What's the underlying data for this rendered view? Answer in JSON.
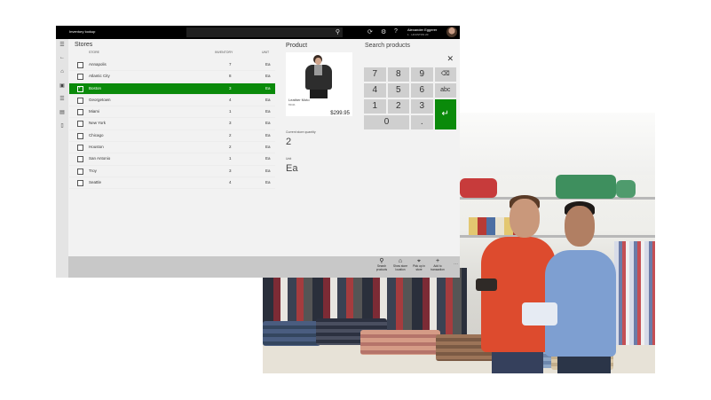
{
  "app": {
    "title": "Inventory lookup",
    "user_name": "Alexander Eggerer",
    "user_store": "1 · HOUSTON 20"
  },
  "titlebar_icons": [
    "refresh-icon",
    "settings-icon",
    "help-icon"
  ],
  "rail_icons": [
    "menu-icon",
    "back-icon",
    "home-icon",
    "products-icon",
    "customers-icon",
    "orders-icon",
    "settings-icon"
  ],
  "stores": {
    "title": "Stores",
    "columns": {
      "store": "STORE",
      "inventory": "INVENTORY",
      "unit": "UNIT"
    },
    "rows": [
      {
        "name": "Annapolis",
        "inventory": "7",
        "unit": "Ea",
        "selected": false
      },
      {
        "name": "Atlantic City",
        "inventory": "8",
        "unit": "Ea",
        "selected": false
      },
      {
        "name": "Boston",
        "inventory": "3",
        "unit": "Ea",
        "selected": true
      },
      {
        "name": "Georgetown",
        "inventory": "4",
        "unit": "Ea",
        "selected": false
      },
      {
        "name": "Miami",
        "inventory": "1",
        "unit": "Ea",
        "selected": false
      },
      {
        "name": "New York",
        "inventory": "3",
        "unit": "Ea",
        "selected": false
      },
      {
        "name": "Chicago",
        "inventory": "2",
        "unit": "Ea",
        "selected": false
      },
      {
        "name": "Houston",
        "inventory": "2",
        "unit": "Ea",
        "selected": false
      },
      {
        "name": "San Antonio",
        "inventory": "1",
        "unit": "Ea",
        "selected": false
      },
      {
        "name": "Troy",
        "inventory": "3",
        "unit": "Ea",
        "selected": false
      },
      {
        "name": "Seattle",
        "inventory": "4",
        "unit": "Ea",
        "selected": false
      }
    ]
  },
  "product": {
    "title": "Product",
    "name": "Leather Moto",
    "id": "81111",
    "price": "$299.95",
    "quantity_label": "Current store quantity",
    "quantity": "2",
    "unit_label": "Unit",
    "unit": "Ea"
  },
  "search_products": {
    "title": "Search products",
    "keys": [
      "7",
      "8",
      "9",
      "⌫",
      "4",
      "5",
      "6",
      "abc",
      "1",
      "2",
      "3",
      "↵",
      "0",
      "."
    ]
  },
  "actions": [
    {
      "label": "Search products",
      "icon": "search-icon"
    },
    {
      "label": "Show store location",
      "icon": "store-icon"
    },
    {
      "label": "Pick up in store",
      "icon": "pickup-icon"
    },
    {
      "label": "Add to transaction",
      "icon": "add-icon"
    }
  ],
  "colors": {
    "accent": "#0a8a0a",
    "titlebar": "#000000"
  }
}
